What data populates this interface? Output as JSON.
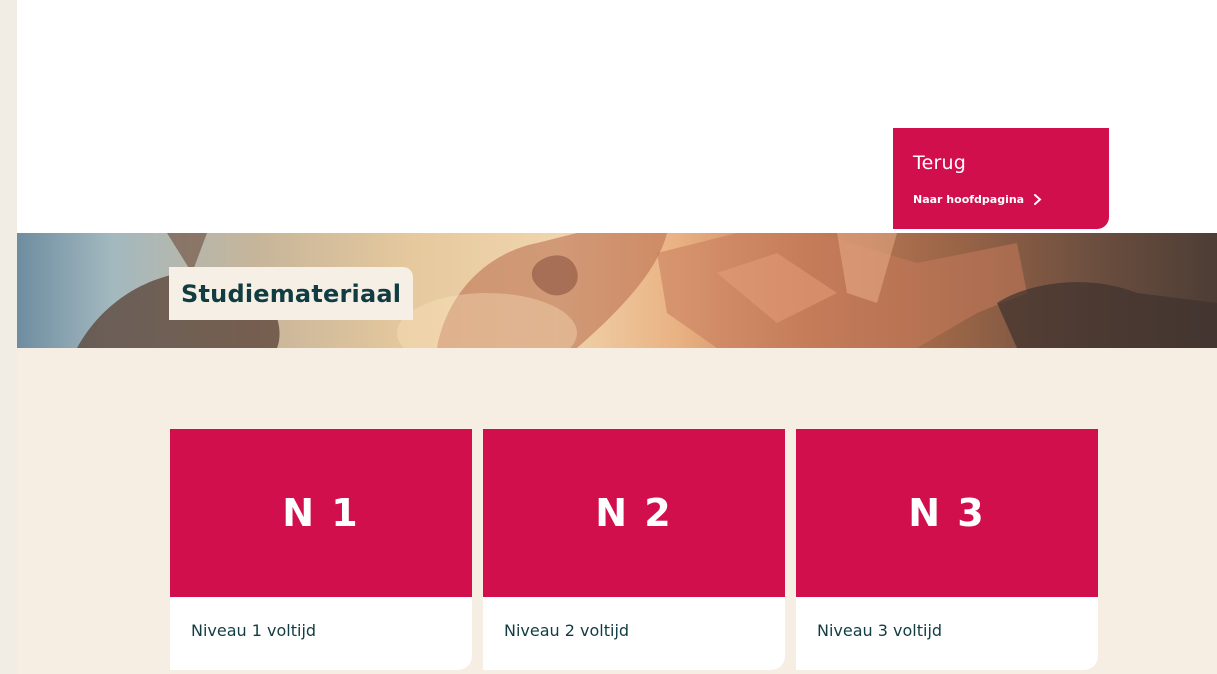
{
  "back": {
    "title": "Terug",
    "link": "Naar hoofdpagina"
  },
  "hero": {
    "title": "Studiemateriaal"
  },
  "cards": [
    {
      "code": "N 1",
      "label": "Niveau 1 voltijd"
    },
    {
      "code": "N 2",
      "label": "Niveau 2 voltijd"
    },
    {
      "code": "N 3",
      "label": "Niveau 3 voltijd"
    }
  ],
  "colors": {
    "accent": "#d10f4c",
    "text_dark": "#103c42",
    "cream": "#f6eee3",
    "sidebar": "#f1ece4"
  }
}
